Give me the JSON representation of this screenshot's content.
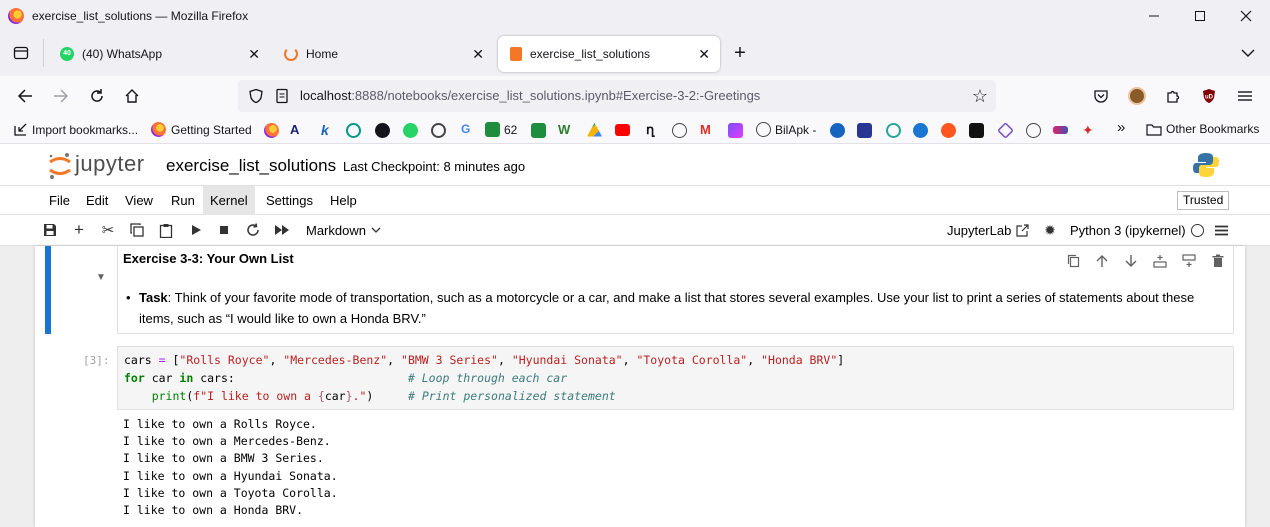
{
  "window": {
    "title": "exercise_list_solutions — Mozilla Firefox"
  },
  "tabs": [
    {
      "label": "(40) WhatsApp",
      "icon": "whatsapp-icon",
      "badge": "40",
      "color": "#25d366"
    },
    {
      "label": "Home",
      "icon": "jupyter-icon",
      "color": "#f37726"
    },
    {
      "label": "exercise_list_solutions",
      "icon": "notebook-icon",
      "color": "#f37726"
    }
  ],
  "url": {
    "host": "localhost",
    "path": ":8888/notebooks/exercise_list_solutions.ipynb#Exercise-3-2:-Greetings"
  },
  "bookmarks": {
    "import": "Import bookmarks...",
    "getting_started": "Getting Started",
    "count_62": "62",
    "bilapk": "BilApk -",
    "other": "Other Bookmarks",
    "more": "»"
  },
  "jupyter": {
    "logo_text": "jupyter",
    "notebook_name": "exercise_list_solutions",
    "checkpoint": "Last Checkpoint: 8 minutes ago"
  },
  "menu": {
    "items": [
      "File",
      "Edit",
      "View",
      "Run",
      "Kernel",
      "Settings",
      "Help"
    ],
    "trusted": "Trusted"
  },
  "toolbar": {
    "cell_type": "Markdown",
    "jupyterlab": "JupyterLab",
    "kernel": "Python 3 (ipykernel)"
  },
  "markdown_cell": {
    "heading": "Exercise 3-3: Your Own List",
    "task_label": "Task",
    "task_text": ": Think of your favorite mode of transportation, such as a motorcycle or a car, and make a list that stores several examples. Use your list to print a series of statements about these items, such as “I would like to own a Honda BRV.”"
  },
  "code_cell": {
    "prompt": "[3]:",
    "line1": {
      "var": "cars ",
      "eq": "=",
      "open": " [",
      "items": [
        "\"Rolls Royce\"",
        "\"Mercedes-Benz\"",
        "\"BMW 3 Series\"",
        "\"Hyundai Sonata\"",
        "\"Toyota Corolla\"",
        "\"Honda BRV\""
      ],
      "sep": ", ",
      "close": "]"
    },
    "line2": {
      "kw_for": "for",
      "mid": " car ",
      "kw_in": "in",
      "rest": " cars:                         ",
      "comment": "# Loop through each car"
    },
    "line3": {
      "indent": "    ",
      "fn": "print",
      "open": "(",
      "fstr_a": "f\"I like to own a ",
      "brace_open": "{",
      "var": "car",
      "brace_close": "}",
      "fstr_b": ".\"",
      "close": ")",
      "pad": "     ",
      "comment": "# Print personalized statement"
    }
  },
  "output_lines": [
    "I like to own a Rolls Royce.",
    "I like to own a Mercedes-Benz.",
    "I like to own a BMW 3 Series.",
    "I like to own a Hyundai Sonata.",
    "I like to own a Toyota Corolla.",
    "I like to own a Honda BRV."
  ]
}
